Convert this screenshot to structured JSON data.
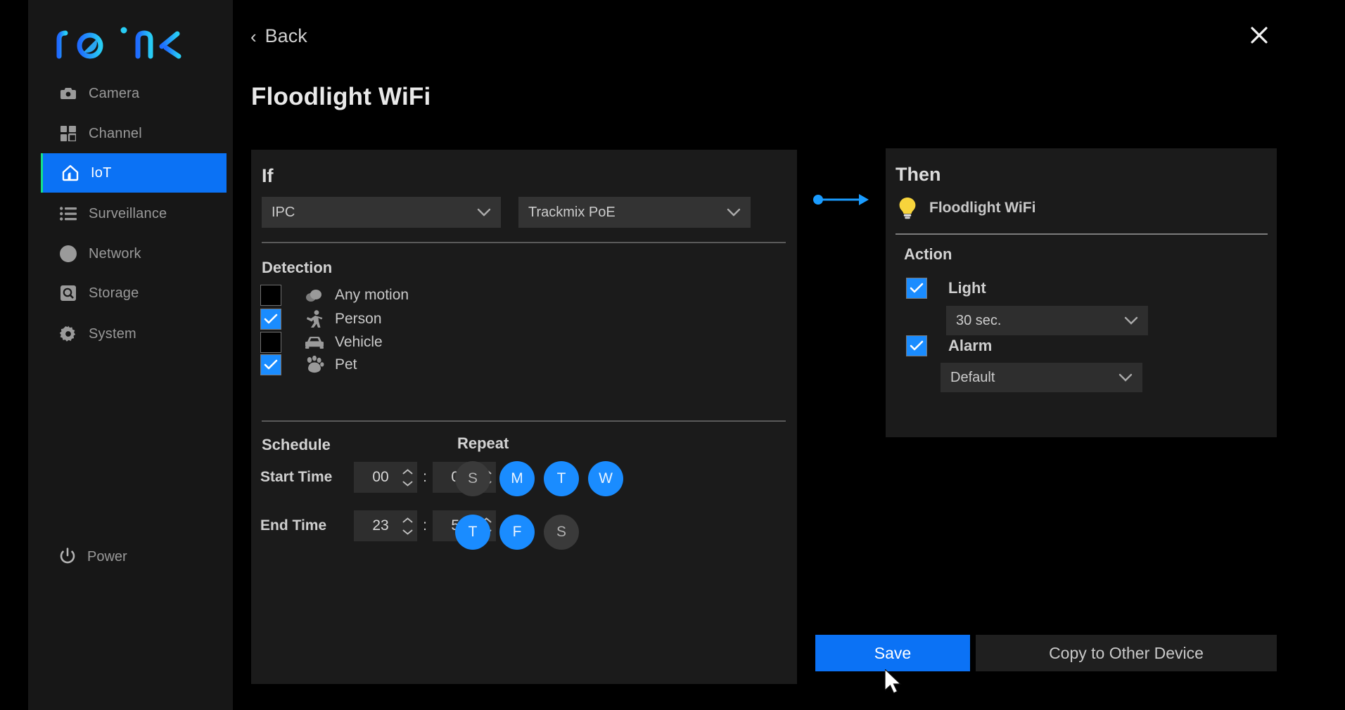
{
  "brand": {
    "name": "reolink",
    "accent": "#0b72f5",
    "accent_cyan": "#22c7f5"
  },
  "sidebar": {
    "items": [
      {
        "label": "Camera",
        "icon": "camera-icon",
        "active": false
      },
      {
        "label": "Channel",
        "icon": "grid-icon",
        "active": false
      },
      {
        "label": "IoT",
        "icon": "home-icon",
        "active": true
      },
      {
        "label": "Surveillance",
        "icon": "list-icon",
        "active": false
      },
      {
        "label": "Network",
        "icon": "globe-icon",
        "active": false
      },
      {
        "label": "Storage",
        "icon": "storage-icon",
        "active": false
      },
      {
        "label": "System",
        "icon": "gear-icon",
        "active": false
      }
    ],
    "power": {
      "label": "Power",
      "icon": "power-icon"
    }
  },
  "header": {
    "back_label": "Back",
    "title": "Floodlight WiFi",
    "close_icon": "close-icon"
  },
  "if_panel": {
    "title": "If",
    "device_type": {
      "value": "IPC"
    },
    "device": {
      "value": "Trackmix PoE"
    },
    "detection_label": "Detection",
    "detection": [
      {
        "label": "Any motion",
        "icon": "motion-icon",
        "checked": false
      },
      {
        "label": "Person",
        "icon": "person-icon",
        "checked": true
      },
      {
        "label": "Vehicle",
        "icon": "vehicle-icon",
        "checked": false
      },
      {
        "label": "Pet",
        "icon": "paw-icon",
        "checked": true
      }
    ],
    "schedule_label": "Schedule",
    "repeat_label": "Repeat",
    "start_time": {
      "label": "Start Time",
      "hour": "00",
      "minute": "00"
    },
    "end_time": {
      "label": "End Time",
      "hour": "23",
      "minute": "59"
    },
    "separator": ":",
    "repeat_days": [
      {
        "letter": "S",
        "name": "sunday",
        "on": false
      },
      {
        "letter": "M",
        "name": "monday",
        "on": true
      },
      {
        "letter": "T",
        "name": "tuesday",
        "on": true
      },
      {
        "letter": "W",
        "name": "wednesday",
        "on": true
      },
      {
        "letter": "T",
        "name": "thursday",
        "on": true
      },
      {
        "letter": "F",
        "name": "friday",
        "on": true
      },
      {
        "letter": "S",
        "name": "saturday",
        "on": false
      }
    ]
  },
  "connector": {
    "icon": "arrow-right-icon",
    "color": "#1a9cff"
  },
  "then_panel": {
    "title": "Then",
    "device_name": "Floodlight WiFi",
    "device_icon": "lightbulb-icon",
    "action_label": "Action",
    "actions": [
      {
        "label": "Light",
        "checked": true,
        "value": "30 sec."
      },
      {
        "label": "Alarm",
        "checked": true,
        "value": "Default"
      }
    ]
  },
  "footer": {
    "save_label": "Save",
    "copy_label": "Copy to Other Device"
  }
}
